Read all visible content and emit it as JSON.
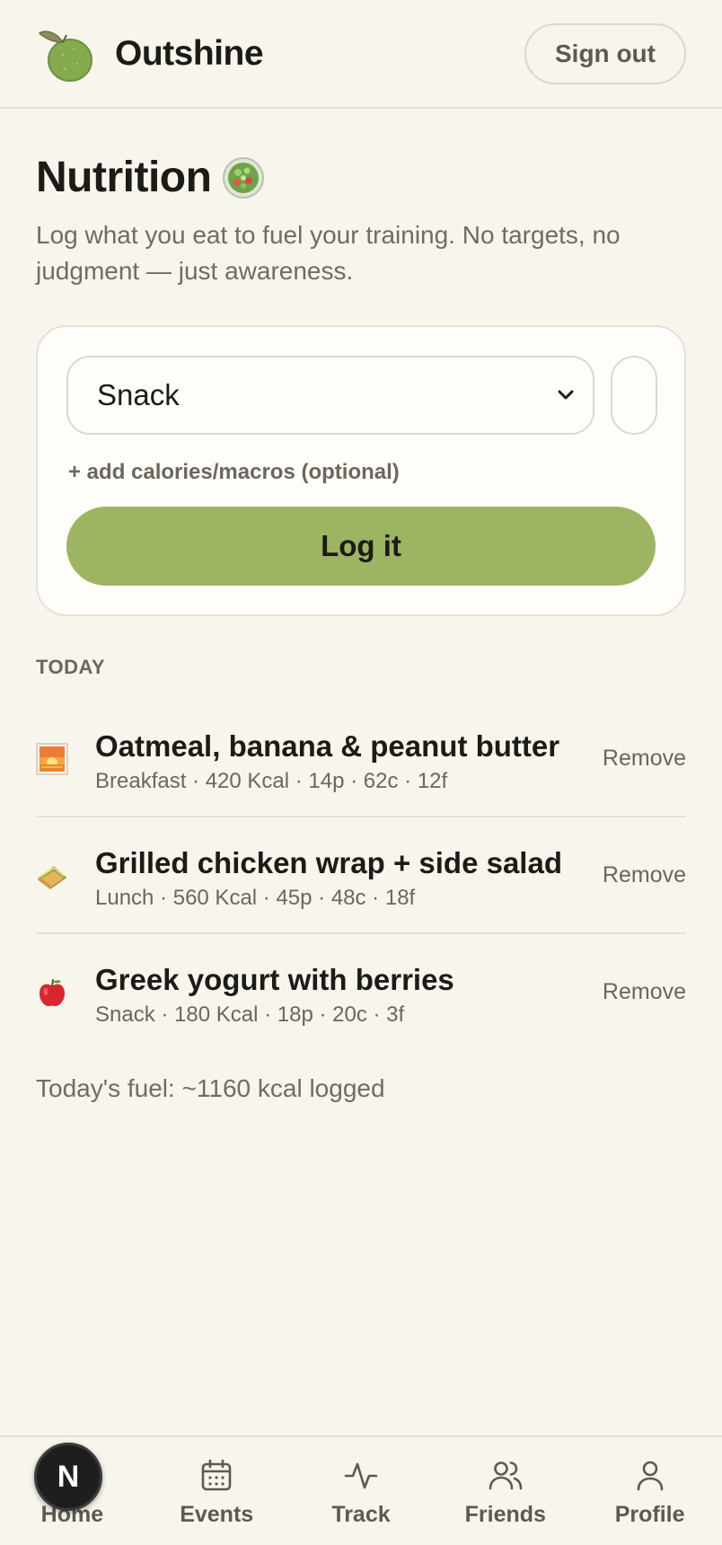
{
  "app": {
    "name": "Outshine"
  },
  "header": {
    "signout_label": "Sign out"
  },
  "page": {
    "title": "Nutrition",
    "subtitle": "Log what you eat to fuel your training. No targets, no judgment — just awareness."
  },
  "log_form": {
    "meal_type_value": "Snack",
    "food_value": "",
    "add_macros_label": "+ add calories/macros (optional)",
    "submit_label": "Log it"
  },
  "today": {
    "section_label": "TODAY",
    "entries": [
      {
        "icon": "sunrise-icon",
        "name": "Oatmeal, banana & peanut butter",
        "meta": "Breakfast · 420 Kcal · 14p · 62c · 12f",
        "remove_label": "Remove"
      },
      {
        "icon": "sandwich-icon",
        "name": "Grilled chicken wrap + side salad",
        "meta": "Lunch · 560 Kcal · 45p · 48c · 18f",
        "remove_label": "Remove"
      },
      {
        "icon": "apple-icon",
        "name": "Greek yogurt with berries",
        "meta": "Snack · 180 Kcal · 18p · 20c · 3f",
        "remove_label": "Remove"
      }
    ],
    "summary": "Today's fuel: ~1160 kcal logged"
  },
  "nav": {
    "items": [
      {
        "label": "Home",
        "icon": "home-icon"
      },
      {
        "label": "Events",
        "icon": "calendar-icon"
      },
      {
        "label": "Track",
        "icon": "activity-icon"
      },
      {
        "label": "Friends",
        "icon": "friends-icon"
      },
      {
        "label": "Profile",
        "icon": "profile-icon"
      }
    ]
  },
  "dev_badge": {
    "letter": "N"
  },
  "colors": {
    "background": "#f8f5ed",
    "card": "#fefdf9",
    "accent": "#9db562",
    "text": "#1c1b17",
    "muted": "#6b675c",
    "border": "#e4e1d8"
  }
}
